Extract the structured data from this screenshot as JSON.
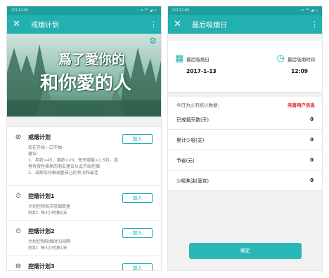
{
  "left": {
    "status": {
      "time": "中午12:09",
      "icons": "... ᯤ ⁴⁶ᴸ ◢ ▭"
    },
    "app_bar": {
      "close": "✕",
      "title": "戒烟计划",
      "more": "⋮"
    },
    "banner": {
      "line1": "爲了愛你的",
      "line2": "和你愛的人",
      "gear": "⚙"
    },
    "plans": [
      {
        "icon": "⊘",
        "name": "戒烟计划",
        "button": "加入",
        "desc": [
          "现在开始一口不抽",
          "建议:",
          "1、年龄>45，烟龄>20，每天烟量>1.5包，或",
          "者有慢性疾病的朋友建议从此开始控烟",
          "2、戒断前仔细调整自己的状况和最佳"
        ]
      },
      {
        "icon": "⏱",
        "name": "控烟计划1",
        "button": "加入",
        "desc": [
          "计划控制每天吸烟数量",
          "例如：每3小时抽1支"
        ]
      },
      {
        "icon": "⏲",
        "name": "控烟计划2",
        "button": "加入",
        "desc": [
          "计划控制吸烟时间间隔",
          "例如：每3小时抽1支"
        ]
      },
      {
        "icon": "⊖",
        "name": "控烟计划3",
        "button": "加入",
        "desc": []
      }
    ]
  },
  "right": {
    "status": {
      "time": "中午12:09",
      "icons": "... ᯤ ⁴⁶ᴸ ◢ ▭"
    },
    "app_bar": {
      "close": "✕",
      "title": "最后吸烟日",
      "more": "⋮"
    },
    "last_date": {
      "label": "最后吸烟日",
      "value": "2017-1-13"
    },
    "last_time": {
      "label": "最后吸烟时间",
      "value": "12:09"
    },
    "stats_heading": "今日为止的统计数据:",
    "complete_link": "完善用户信息",
    "stats": [
      {
        "label": "已戒烟天数(天)",
        "value": "0"
      },
      {
        "label": "累计少吸(支)",
        "value": "0"
      },
      {
        "label": "节省(元)",
        "value": "0"
      },
      {
        "label": "少吸焦油(毫克)",
        "value": "0"
      }
    ],
    "confirm": "确定"
  },
  "colors": {
    "teal": "#22b0b0",
    "status_teal": "#1e9e9e",
    "link_red": "#e02020"
  }
}
